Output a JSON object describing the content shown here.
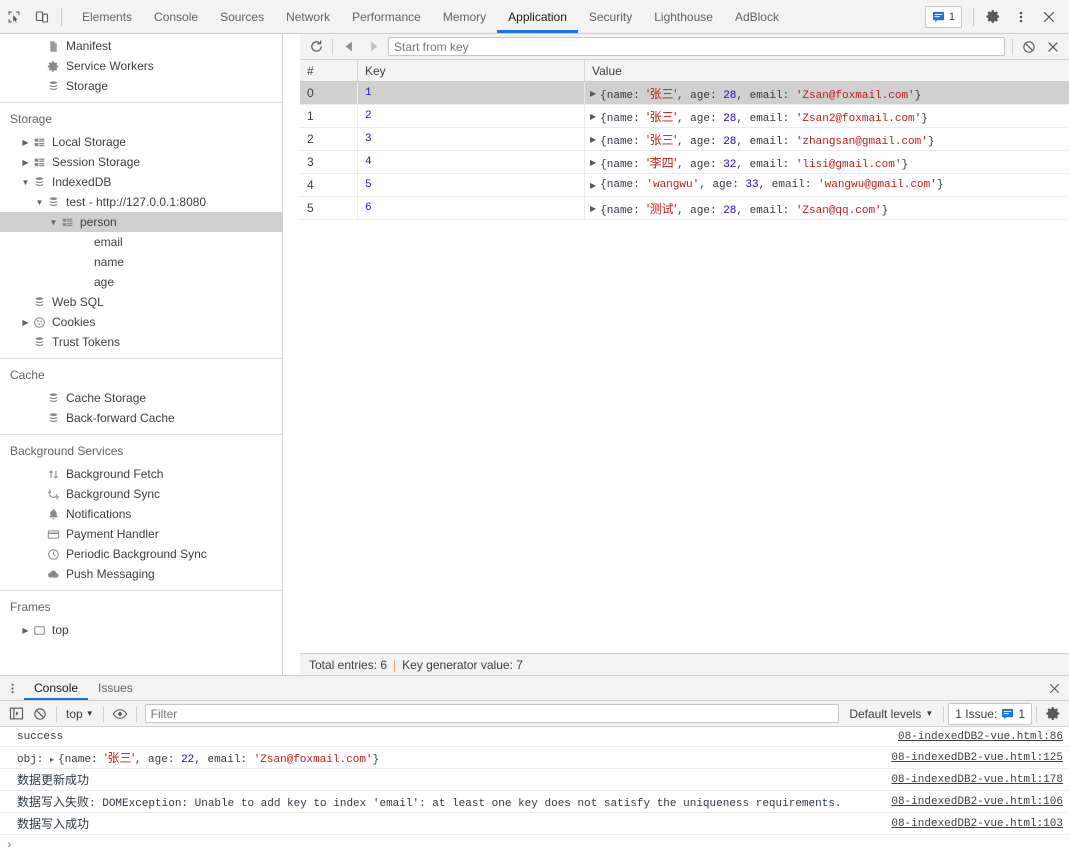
{
  "topbar": {
    "icons": [
      {
        "name": "inspect-element-icon"
      },
      {
        "name": "device-toolbar-icon"
      }
    ],
    "tabs": [
      {
        "label": "Elements",
        "active": false
      },
      {
        "label": "Console",
        "active": false
      },
      {
        "label": "Sources",
        "active": false
      },
      {
        "label": "Network",
        "active": false
      },
      {
        "label": "Performance",
        "active": false
      },
      {
        "label": "Memory",
        "active": false
      },
      {
        "label": "Application",
        "active": true
      },
      {
        "label": "Security",
        "active": false
      },
      {
        "label": "Lighthouse",
        "active": false
      },
      {
        "label": "AdBlock",
        "active": false
      }
    ],
    "issues_count": "1",
    "settings_label": "Settings",
    "more_label": "Customize and control DevTools",
    "close_label": "Close DevTools",
    "accent_color": "#1a73e8"
  },
  "sidebar": {
    "sections": [
      {
        "title": null,
        "items": [
          {
            "label": "Manifest",
            "icon": "manifest-icon",
            "indent": 2,
            "arrow": "none",
            "selected": false
          },
          {
            "label": "Service Workers",
            "icon": "gear-icon",
            "indent": 2,
            "arrow": "none",
            "selected": false
          },
          {
            "label": "Storage",
            "icon": "database-icon",
            "indent": 2,
            "arrow": "none",
            "selected": false
          }
        ]
      },
      {
        "title": "Storage",
        "items": [
          {
            "label": "Local Storage",
            "icon": "table-icon",
            "indent": 1,
            "arrow": "collapsed",
            "selected": false
          },
          {
            "label": "Session Storage",
            "icon": "table-icon",
            "indent": 1,
            "arrow": "collapsed",
            "selected": false
          },
          {
            "label": "IndexedDB",
            "icon": "database-icon",
            "indent": 1,
            "arrow": "expanded",
            "selected": false
          },
          {
            "label": "test - http://127.0.0.1:8080",
            "icon": "database-icon",
            "indent": 2,
            "arrow": "expanded",
            "selected": false
          },
          {
            "label": "person",
            "icon": "table-icon",
            "indent": 3,
            "arrow": "expanded",
            "selected": true
          },
          {
            "label": "email",
            "icon": "none",
            "indent": 4,
            "arrow": "none",
            "selected": false
          },
          {
            "label": "name",
            "icon": "none",
            "indent": 4,
            "arrow": "none",
            "selected": false
          },
          {
            "label": "age",
            "icon": "none",
            "indent": 4,
            "arrow": "none",
            "selected": false
          },
          {
            "label": "Web SQL",
            "icon": "database-icon",
            "indent": 1,
            "arrow": "none",
            "selected": false
          },
          {
            "label": "Cookies",
            "icon": "cookie-icon",
            "indent": 1,
            "arrow": "collapsed",
            "selected": false
          },
          {
            "label": "Trust Tokens",
            "icon": "database-icon",
            "indent": 1,
            "arrow": "none",
            "selected": false
          }
        ]
      },
      {
        "title": "Cache",
        "items": [
          {
            "label": "Cache Storage",
            "icon": "database-icon",
            "indent": 2,
            "arrow": "none",
            "selected": false
          },
          {
            "label": "Back-forward Cache",
            "icon": "database-icon",
            "indent": 2,
            "arrow": "none",
            "selected": false
          }
        ]
      },
      {
        "title": "Background Services",
        "items": [
          {
            "label": "Background Fetch",
            "icon": "fetch-arrows-icon",
            "indent": 2,
            "arrow": "none",
            "selected": false
          },
          {
            "label": "Background Sync",
            "icon": "sync-icon",
            "indent": 2,
            "arrow": "none",
            "selected": false
          },
          {
            "label": "Notifications",
            "icon": "bell-icon",
            "indent": 2,
            "arrow": "none",
            "selected": false
          },
          {
            "label": "Payment Handler",
            "icon": "credit-card-icon",
            "indent": 2,
            "arrow": "none",
            "selected": false
          },
          {
            "label": "Periodic Background Sync",
            "icon": "clock-icon",
            "indent": 2,
            "arrow": "none",
            "selected": false
          },
          {
            "label": "Push Messaging",
            "icon": "cloud-icon",
            "indent": 2,
            "arrow": "none",
            "selected": false
          }
        ]
      },
      {
        "title": "Frames",
        "items": [
          {
            "label": "top",
            "icon": "frame-icon",
            "indent": 1,
            "arrow": "collapsed",
            "selected": false
          }
        ]
      }
    ]
  },
  "main": {
    "toolbar": {
      "refresh_label": "Refresh",
      "prev_label": "Show previous page",
      "next_label": "Show next page",
      "start_from_key_placeholder": "Start from key",
      "start_from_key_value": "",
      "clear_all_label": "Clear object store",
      "delete_selected_label": "Delete selected"
    },
    "table": {
      "columns": [
        "#",
        "Key",
        "Value"
      ],
      "rows": [
        {
          "index": "0",
          "key": "1",
          "value": "{name: '张三', age: 28, email: 'Zsan@foxmail.com'}",
          "name": "张三",
          "age": "28",
          "email": "Zsan@foxmail.com",
          "selected": true
        },
        {
          "index": "1",
          "key": "2",
          "value": "{name: '张三', age: 28, email: 'Zsan2@foxmail.com'}",
          "name": "张三",
          "age": "28",
          "email": "Zsan2@foxmail.com",
          "selected": false
        },
        {
          "index": "2",
          "key": "3",
          "value": "{name: '张三', age: 28, email: 'zhangsan@gmail.com'}",
          "name": "张三",
          "age": "28",
          "email": "zhangsan@gmail.com",
          "selected": false
        },
        {
          "index": "3",
          "key": "4",
          "value": "{name: '李四', age: 32, email: 'lisi@gmail.com'}",
          "name": "李四",
          "age": "32",
          "email": "lisi@gmail.com",
          "selected": false
        },
        {
          "index": "4",
          "key": "5",
          "value": "{name: 'wangwu', age: 33, email: 'wangwu@gmail.com'}",
          "name": "wangwu",
          "age": "33",
          "email": "wangwu@gmail.com",
          "selected": false
        },
        {
          "index": "5",
          "key": "6",
          "value": "{name: '测试', age: 28, email: 'Zsan@qq.com'}",
          "name": "测试",
          "age": "28",
          "email": "Zsan@qq.com",
          "selected": false
        }
      ]
    },
    "status": {
      "total_entries": "Total entries: 6",
      "divider": "|",
      "key_generator": "Key generator value: 7"
    }
  },
  "drawer": {
    "menu_label": "More tools",
    "tabs": [
      {
        "label": "Console",
        "active": true
      },
      {
        "label": "Issues",
        "active": false
      }
    ],
    "close_label": "Close drawer",
    "toolbar": {
      "sidebar_toggle_label": "Show console sidebar",
      "clear_console_label": "Clear console",
      "context": "top",
      "eye_label": "Create live expression",
      "filter_placeholder": "Filter",
      "filter_value": "",
      "levels_label": "Default levels",
      "issues_label": "1 Issue:",
      "issues_count": "1",
      "settings_label": "Console settings"
    },
    "messages": [
      {
        "segments": [
          {
            "t": "success",
            "c": "plain"
          }
        ],
        "source": "08-indexedDB2-vue.html:86"
      },
      {
        "segments": [
          {
            "t": "obj: ",
            "c": "plain"
          },
          {
            "t": "▸",
            "c": "tri"
          },
          {
            "t": "{name: ",
            "c": "plain"
          },
          {
            "t": "'张三'",
            "c": "str"
          },
          {
            "t": ", age: ",
            "c": "plain"
          },
          {
            "t": "22",
            "c": "num"
          },
          {
            "t": ", email: ",
            "c": "plain"
          },
          {
            "t": "'Zsan@foxmail.com'",
            "c": "str"
          },
          {
            "t": "}",
            "c": "plain"
          }
        ],
        "source": "08-indexedDB2-vue.html:125"
      },
      {
        "segments": [
          {
            "t": "数据更新成功",
            "c": "cjk"
          }
        ],
        "source": "08-indexedDB2-vue.html:178"
      },
      {
        "segments": [
          {
            "t": "数据写入失败",
            "c": "cjk"
          },
          {
            "t": ": DOMException: Unable to add key to index 'email': at least one key does not satisfy the uniqueness requirements.",
            "c": "plain"
          }
        ],
        "source": "08-indexedDB2-vue.html:106"
      },
      {
        "segments": [
          {
            "t": "数据写入成功",
            "c": "cjk"
          }
        ],
        "source": "08-indexedDB2-vue.html:103"
      }
    ],
    "prompt": "›"
  }
}
